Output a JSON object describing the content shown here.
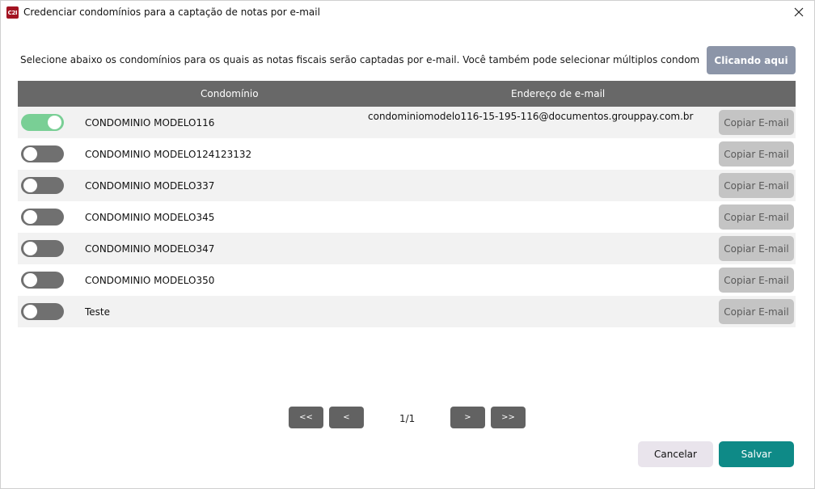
{
  "window": {
    "title": "Credenciar condomínios para a captação de notas por e-mail",
    "app_icon_text": "C2I"
  },
  "instruction": {
    "text": "Selecione abaixo os condomínios para os quais as notas fiscais serão captadas por e-mail. Você também pode selecionar múltiplos condomínios de uma vez...",
    "button_label": "Clicando aqui"
  },
  "table": {
    "headers": {
      "condominio": "Condomínio",
      "email": "Endereço de e-mail"
    },
    "rows": [
      {
        "name": "CONDOMINIO MODELO116",
        "email": "condominiomodelo116-15-195-116@documentos.grouppay.com.br",
        "enabled": true,
        "copy_label": "Copiar E-mail"
      },
      {
        "name": "CONDOMINIO MODELO124123132",
        "email": "",
        "enabled": false,
        "copy_label": "Copiar E-mail"
      },
      {
        "name": "CONDOMINIO MODELO337",
        "email": "",
        "enabled": false,
        "copy_label": "Copiar E-mail"
      },
      {
        "name": "CONDOMINIO MODELO345",
        "email": "",
        "enabled": false,
        "copy_label": "Copiar E-mail"
      },
      {
        "name": "CONDOMINIO MODELO347",
        "email": "",
        "enabled": false,
        "copy_label": "Copiar E-mail"
      },
      {
        "name": "CONDOMINIO MODELO350",
        "email": "",
        "enabled": false,
        "copy_label": "Copiar E-mail"
      },
      {
        "name": "Teste",
        "email": "",
        "enabled": false,
        "copy_label": "Copiar E-mail"
      }
    ]
  },
  "pagination": {
    "first": "<<",
    "prev": "<",
    "indicator": "1/1",
    "next": ">",
    "last": ">>"
  },
  "footer": {
    "cancel": "Cancelar",
    "save": "Salvar"
  },
  "colors": {
    "toggle_on": "#79cf95",
    "toggle_off": "#707070",
    "header_bg": "#686868",
    "save_bg": "#0e8a87",
    "clicando_bg": "#8c95a8"
  },
  "icons": {
    "close": "close-icon",
    "app": "app-logo-icon"
  }
}
